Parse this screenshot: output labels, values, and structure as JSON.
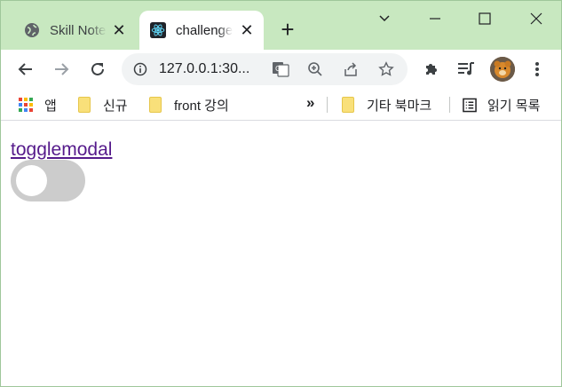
{
  "colors": {
    "frame": "#c8e8c0",
    "link_visited": "#551a8b",
    "toggle_off": "#cccccc"
  },
  "tabs": [
    {
      "title": "Skill Note",
      "favicon": "globe-icon",
      "active": false
    },
    {
      "title": "challenge",
      "favicon": "react-icon",
      "active": true
    }
  ],
  "window_controls": {
    "minimize": "minimize-icon",
    "maximize": "maximize-icon",
    "close": "close-icon",
    "tab_search": "chevron-down-icon"
  },
  "address_bar": {
    "url": "127.0.0.1:30...",
    "icons": [
      "info-icon",
      "translate-icon",
      "zoom-icon",
      "share-icon",
      "star-icon"
    ]
  },
  "bookmarks": [
    {
      "label": "앱",
      "icon": "apps-grid-icon"
    },
    {
      "label": "신규",
      "icon": "folder-icon"
    },
    {
      "label": "front 강의",
      "icon": "folder-icon"
    },
    {
      "label": "»",
      "icon": "more-bookmarks-icon"
    },
    {
      "label": "기타 북마크",
      "icon": "folder-icon"
    },
    {
      "label": "읽기 목록",
      "icon": "reading-list-icon"
    }
  ],
  "page": {
    "link_text": "togglemodal",
    "toggle_on": false
  }
}
